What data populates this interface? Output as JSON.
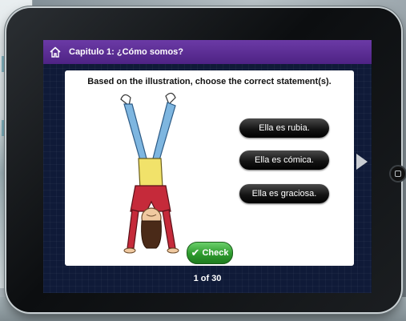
{
  "header": {
    "title": "Capitulo 1: ¿Cómo somos?",
    "home_icon": "home-icon"
  },
  "question": {
    "prompt": "Based on the illustration, choose the correct statement(s)."
  },
  "options": [
    {
      "label": "Ella es rubia."
    },
    {
      "label": "Ella es cómica."
    },
    {
      "label": "Ella es graciosa."
    }
  ],
  "check_button": {
    "label": "Check",
    "icon": "checkmark-icon"
  },
  "progress": {
    "text": "1 of 30"
  },
  "colors": {
    "header_purple": "#5b2b95",
    "screen_navy": "#0f1a38",
    "button_black": "#151515",
    "check_green": "#2e9a2e"
  }
}
